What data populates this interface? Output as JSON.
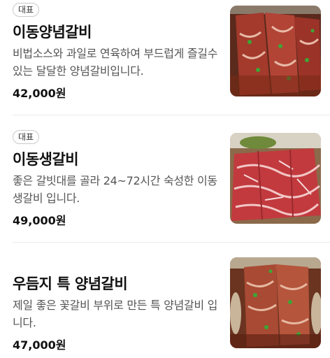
{
  "menu": {
    "items": [
      {
        "badge": "대표",
        "name": "이동양념갈비",
        "description": "비법소스와 과일로 연육하여 부드럽게 즐길수있는 달달한 양념갈비입니다.",
        "price": "42,000원",
        "photo_icon": "marinated-galbi-photo"
      },
      {
        "badge": "대표",
        "name": "이동생갈비",
        "description": "좋은 갈빗대를 골라 24~72시간 숙성한 이동생갈비 입니다.",
        "price": "49,000원",
        "photo_icon": "raw-galbi-photo"
      },
      {
        "badge": "",
        "name": "우듬지 특 양념갈비",
        "description": "제일 좋은 꽃갈비 부위로 만든 특 양념갈비 입니다.",
        "price": "47,000원",
        "photo_icon": "special-marinated-galbi-photo"
      }
    ]
  },
  "colors": {
    "price_text": "#111111",
    "description_text": "#555555",
    "badge_border": "#c9c9c9",
    "divider": "#ececec"
  }
}
